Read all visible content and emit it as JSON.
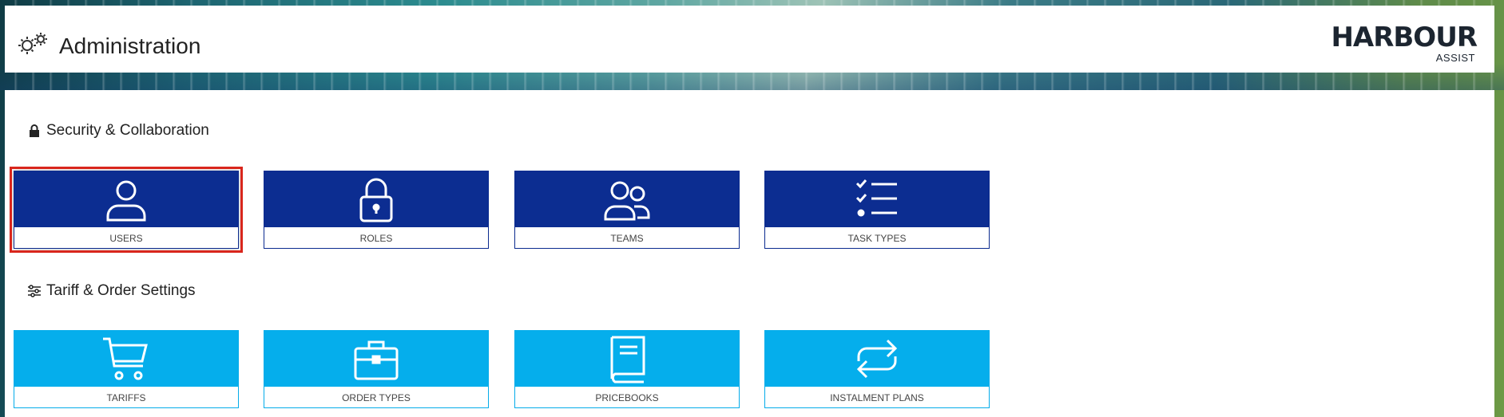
{
  "header": {
    "title": "Administration",
    "title_icon": "gears-icon",
    "brand": {
      "name": "HARBOUR",
      "sub": "ASSIST"
    }
  },
  "sections": [
    {
      "title": "Security & Collaboration",
      "icon": "lock-icon",
      "tiles": [
        {
          "label": "USERS",
          "icon": "user-icon",
          "selected": true
        },
        {
          "label": "ROLES",
          "icon": "padlock-icon"
        },
        {
          "label": "TEAMS",
          "icon": "team-icon"
        },
        {
          "label": "TASK TYPES",
          "icon": "checklist-icon"
        }
      ]
    },
    {
      "title": "Tariff & Order Settings",
      "icon": "sliders-icon",
      "tiles": [
        {
          "label": "TARIFFS",
          "icon": "cart-icon"
        },
        {
          "label": "ORDER TYPES",
          "icon": "briefcase-icon"
        },
        {
          "label": "PRICEBOOKS",
          "icon": "book-icon"
        },
        {
          "label": "INSTALMENT PLANS",
          "icon": "repeat-icon"
        }
      ]
    }
  ],
  "colors": {
    "security_tile": "#0c2d91",
    "tariff_tile": "#05aeec",
    "selection_outline": "#d9261c"
  }
}
